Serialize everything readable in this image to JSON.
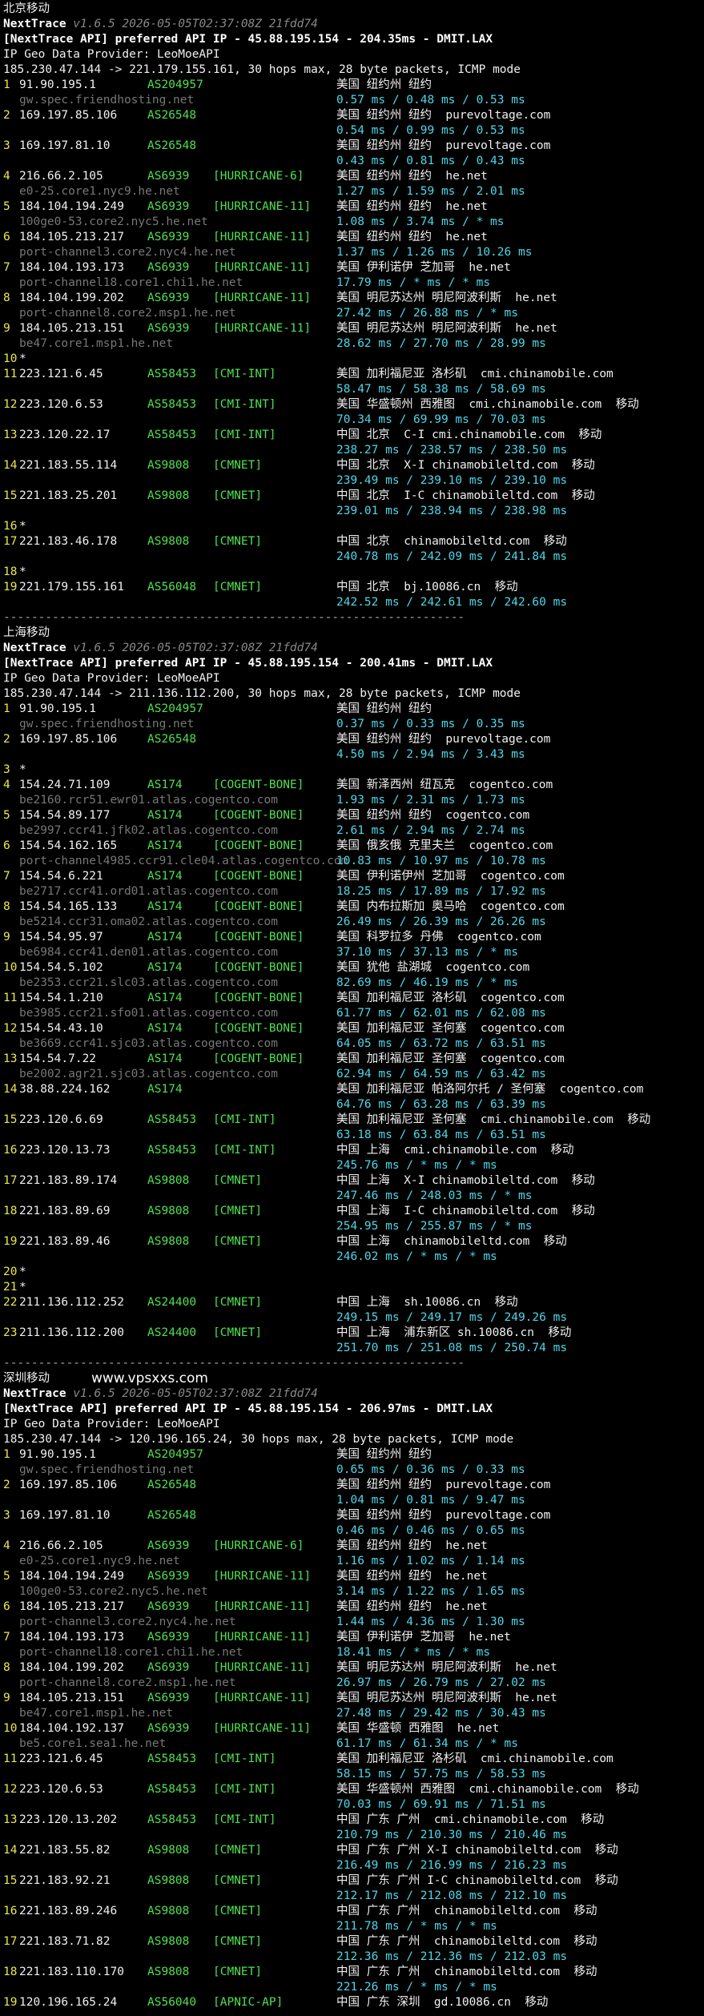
{
  "brand": "NextTrace",
  "meta": "v1.6.5 2026-05-05T02:37:08Z 21fdd74",
  "geo_provider": "IP Geo Data Provider: LeoMoeAPI",
  "separator": "------------------------------------------------------------------",
  "watermark": "www.vpsxxs.com",
  "sections": [
    {
      "title": "北京移动",
      "api": "[NextTrace API] preferred API IP - 45.88.195.154 - 204.35ms - DMIT.LAX",
      "route": "185.230.47.144 -> 221.179.155.161, 30 hops max, 28 byte packets, ICMP mode",
      "hops": [
        {
          "n": "1",
          "ip": "91.90.195.1",
          "as": "AS204957",
          "tag": "",
          "geo": "美国 纽约州 纽约",
          "host": "gw.spec.friendhosting.net",
          "lat": "0.57 ms / 0.48 ms / 0.53 ms"
        },
        {
          "n": "2",
          "ip": "169.197.85.106",
          "as": "AS26548",
          "tag": "",
          "geo": "美国 纽约州 纽约  purevoltage.com",
          "host": "",
          "lat": "0.54 ms / 0.99 ms / 0.53 ms"
        },
        {
          "n": "3",
          "ip": "169.197.81.10",
          "as": "AS26548",
          "tag": "",
          "geo": "美国 纽约州 纽约  purevoltage.com",
          "host": "",
          "lat": "0.43 ms / 0.81 ms / 0.43 ms"
        },
        {
          "n": "4",
          "ip": "216.66.2.105",
          "as": "AS6939",
          "tag": "[HURRICANE-6]",
          "geo": "美国 纽约州 纽约  he.net",
          "host": "e0-25.core1.nyc9.he.net",
          "lat": "1.27 ms / 1.59 ms / 2.01 ms"
        },
        {
          "n": "5",
          "ip": "184.104.194.249",
          "as": "AS6939",
          "tag": "[HURRICANE-11]",
          "geo": "美国 纽约州 纽约  he.net",
          "host": "100ge0-53.core2.nyc5.he.net",
          "lat": "1.08 ms / 3.74 ms / * ms"
        },
        {
          "n": "6",
          "ip": "184.105.213.217",
          "as": "AS6939",
          "tag": "[HURRICANE-11]",
          "geo": "美国 纽约州 纽约  he.net",
          "host": "port-channel3.core2.nyc4.he.net",
          "lat": "1.37 ms / 1.26 ms / 10.26 ms"
        },
        {
          "n": "7",
          "ip": "184.104.193.173",
          "as": "AS6939",
          "tag": "[HURRICANE-11]",
          "geo": "美国 伊利诺伊 芝加哥  he.net",
          "host": "port-channel18.core1.chi1.he.net",
          "lat": "17.79 ms / * ms / * ms"
        },
        {
          "n": "8",
          "ip": "184.104.199.202",
          "as": "AS6939",
          "tag": "[HURRICANE-11]",
          "geo": "美国 明尼苏达州 明尼阿波利斯  he.net",
          "host": "port-channel8.core2.msp1.he.net",
          "lat": "27.42 ms / 26.88 ms / * ms"
        },
        {
          "n": "9",
          "ip": "184.105.213.151",
          "as": "AS6939",
          "tag": "[HURRICANE-11]",
          "geo": "美国 明尼苏达州 明尼阿波利斯  he.net",
          "host": "be47.core1.msp1.he.net",
          "lat": "28.62 ms / 27.70 ms / 28.99 ms"
        },
        {
          "n": "10",
          "ip": "*",
          "as": "",
          "tag": "",
          "geo": "",
          "host": "",
          "lat": ""
        },
        {
          "n": "11",
          "ip": "223.121.6.45",
          "as": "AS58453",
          "tag": "[CMI-INT]",
          "geo": "美国 加利福尼亚 洛杉矶  cmi.chinamobile.com",
          "host": "",
          "lat": "58.47 ms / 58.38 ms / 58.69 ms"
        },
        {
          "n": "12",
          "ip": "223.120.6.53",
          "as": "AS58453",
          "tag": "[CMI-INT]",
          "geo": "美国 华盛顿州 西雅图  cmi.chinamobile.com  移动",
          "host": "",
          "lat": "70.34 ms / 69.99 ms / 70.03 ms"
        },
        {
          "n": "13",
          "ip": "223.120.22.17",
          "as": "AS58453",
          "tag": "[CMI-INT]",
          "geo": "中国 北京  C-I cmi.chinamobile.com  移动",
          "host": "",
          "lat": "238.27 ms / 238.57 ms / 238.50 ms"
        },
        {
          "n": "14",
          "ip": "221.183.55.114",
          "as": "AS9808",
          "tag": "[CMNET]",
          "geo": "中国 北京  X-I chinamobileltd.com  移动",
          "host": "",
          "lat": "239.49 ms / 239.10 ms / 239.10 ms"
        },
        {
          "n": "15",
          "ip": "221.183.25.201",
          "as": "AS9808",
          "tag": "[CMNET]",
          "geo": "中国 北京  I-C chinamobileltd.com  移动",
          "host": "",
          "lat": "239.01 ms / 238.94 ms / 238.98 ms"
        },
        {
          "n": "16",
          "ip": "*",
          "as": "",
          "tag": "",
          "geo": "",
          "host": "",
          "lat": ""
        },
        {
          "n": "17",
          "ip": "221.183.46.178",
          "as": "AS9808",
          "tag": "[CMNET]",
          "geo": "中国 北京  chinamobileltd.com  移动",
          "host": "",
          "lat": "240.78 ms / 242.09 ms / 241.84 ms"
        },
        {
          "n": "18",
          "ip": "*",
          "as": "",
          "tag": "",
          "geo": "",
          "host": "",
          "lat": ""
        },
        {
          "n": "19",
          "ip": "221.179.155.161",
          "as": "AS56048",
          "tag": "[CMNET]",
          "geo": "中国 北京  bj.10086.cn  移动",
          "host": "",
          "lat": "242.52 ms / 242.61 ms / 242.60 ms"
        }
      ]
    },
    {
      "title": "上海移动",
      "api": "[NextTrace API] preferred API IP - 45.88.195.154 - 200.41ms - DMIT.LAX",
      "route": "185.230.47.144 -> 211.136.112.200, 30 hops max, 28 byte packets, ICMP mode",
      "hops": [
        {
          "n": "1",
          "ip": "91.90.195.1",
          "as": "AS204957",
          "tag": "",
          "geo": "美国 纽约州 纽约",
          "host": "gw.spec.friendhosting.net",
          "lat": "0.37 ms / 0.33 ms / 0.35 ms"
        },
        {
          "n": "2",
          "ip": "169.197.85.106",
          "as": "AS26548",
          "tag": "",
          "geo": "美国 纽约州 纽约  purevoltage.com",
          "host": "",
          "lat": "4.50 ms / 2.94 ms / 3.43 ms"
        },
        {
          "n": "3",
          "ip": "*",
          "as": "",
          "tag": "",
          "geo": "",
          "host": "",
          "lat": ""
        },
        {
          "n": "4",
          "ip": "154.24.71.109",
          "as": "AS174",
          "tag": "[COGENT-BONE]",
          "geo": "美国 新泽西州 纽瓦克  cogentco.com",
          "host": "be2160.rcr51.ewr01.atlas.cogentco.com",
          "lat": "1.93 ms / 2.31 ms / 1.73 ms"
        },
        {
          "n": "5",
          "ip": "154.54.89.177",
          "as": "AS174",
          "tag": "[COGENT-BONE]",
          "geo": "美国 纽约州 纽约  cogentco.com",
          "host": "be2997.ccr41.jfk02.atlas.cogentco.com",
          "lat": "2.61 ms / 2.94 ms / 2.74 ms"
        },
        {
          "n": "6",
          "ip": "154.54.162.165",
          "as": "AS174",
          "tag": "[COGENT-BONE]",
          "geo": "美国 俄亥俄 克里夫兰  cogentco.com",
          "host": "port-channel4985.ccr91.cle04.atlas.cogentco.com",
          "lat": "10.83 ms / 10.97 ms / 10.78 ms"
        },
        {
          "n": "7",
          "ip": "154.54.6.221",
          "as": "AS174",
          "tag": "[COGENT-BONE]",
          "geo": "美国 伊利诺伊州 芝加哥  cogentco.com",
          "host": "be2717.ccr41.ord01.atlas.cogentco.com",
          "lat": "18.25 ms / 17.89 ms / 17.92 ms"
        },
        {
          "n": "8",
          "ip": "154.54.165.133",
          "as": "AS174",
          "tag": "[COGENT-BONE]",
          "geo": "美国 内布拉斯加 奥马哈  cogentco.com",
          "host": "be5214.ccr31.oma02.atlas.cogentco.com",
          "lat": "26.49 ms / 26.39 ms / 26.26 ms"
        },
        {
          "n": "9",
          "ip": "154.54.95.97",
          "as": "AS174",
          "tag": "[COGENT-BONE]",
          "geo": "美国 科罗拉多 丹佛  cogentco.com",
          "host": "be6984.ccr41.den01.atlas.cogentco.com",
          "lat": "37.10 ms / 37.13 ms / * ms"
        },
        {
          "n": "10",
          "ip": "154.54.5.102",
          "as": "AS174",
          "tag": "[COGENT-BONE]",
          "geo": "美国 犹他 盐湖城  cogentco.com",
          "host": "be2353.ccr21.slc03.atlas.cogentco.com",
          "lat": "82.69 ms / 46.19 ms / * ms"
        },
        {
          "n": "11",
          "ip": "154.54.1.210",
          "as": "AS174",
          "tag": "[COGENT-BONE]",
          "geo": "美国 加利福尼亚 洛杉矶  cogentco.com",
          "host": "be3985.ccr21.sfo01.atlas.cogentco.com",
          "lat": "61.77 ms / 62.01 ms / 62.08 ms"
        },
        {
          "n": "12",
          "ip": "154.54.43.10",
          "as": "AS174",
          "tag": "[COGENT-BONE]",
          "geo": "美国 加利福尼亚 圣何塞  cogentco.com",
          "host": "be3669.ccr41.sjc03.atlas.cogentco.com",
          "lat": "64.05 ms / 63.72 ms / 63.51 ms"
        },
        {
          "n": "13",
          "ip": "154.54.7.22",
          "as": "AS174",
          "tag": "[COGENT-BONE]",
          "geo": "美国 加利福尼亚 圣何塞  cogentco.com",
          "host": "be2002.agr21.sjc03.atlas.cogentco.com",
          "lat": "62.94 ms / 64.59 ms / 63.42 ms"
        },
        {
          "n": "14",
          "ip": "38.88.224.162",
          "as": "AS174",
          "tag": "",
          "geo": "美国 加利福尼亚 帕洛阿尔托 / 圣何塞  cogentco.com",
          "host": "",
          "lat": "64.76 ms / 63.28 ms / 63.39 ms"
        },
        {
          "n": "15",
          "ip": "223.120.6.69",
          "as": "AS58453",
          "tag": "[CMI-INT]",
          "geo": "美国 加利福尼亚 圣何塞  cmi.chinamobile.com  移动",
          "host": "",
          "lat": "63.18 ms / 63.84 ms / 63.51 ms"
        },
        {
          "n": "16",
          "ip": "223.120.13.73",
          "as": "AS58453",
          "tag": "[CMI-INT]",
          "geo": "中国 上海  cmi.chinamobile.com  移动",
          "host": "",
          "lat": "245.76 ms / * ms / * ms"
        },
        {
          "n": "17",
          "ip": "221.183.89.174",
          "as": "AS9808",
          "tag": "[CMNET]",
          "geo": "中国 上海  X-I chinamobileltd.com  移动",
          "host": "",
          "lat": "247.46 ms / 248.03 ms / * ms"
        },
        {
          "n": "18",
          "ip": "221.183.89.69",
          "as": "AS9808",
          "tag": "[CMNET]",
          "geo": "中国 上海  I-C chinamobileltd.com  移动",
          "host": "",
          "lat": "254.95 ms / 255.87 ms / * ms"
        },
        {
          "n": "19",
          "ip": "221.183.89.46",
          "as": "AS9808",
          "tag": "[CMNET]",
          "geo": "中国 上海  chinamobileltd.com  移动",
          "host": "",
          "lat": "246.02 ms / * ms / * ms"
        },
        {
          "n": "20",
          "ip": "*",
          "as": "",
          "tag": "",
          "geo": "",
          "host": "",
          "lat": ""
        },
        {
          "n": "21",
          "ip": "*",
          "as": "",
          "tag": "",
          "geo": "",
          "host": "",
          "lat": ""
        },
        {
          "n": "22",
          "ip": "211.136.112.252",
          "as": "AS24400",
          "tag": "[CMNET]",
          "geo": "中国 上海  sh.10086.cn  移动",
          "host": "",
          "lat": "249.15 ms / 249.17 ms / 249.26 ms"
        },
        {
          "n": "23",
          "ip": "211.136.112.200",
          "as": "AS24400",
          "tag": "[CMNET]",
          "geo": "中国 上海  浦东新区 sh.10086.cn  移动",
          "host": "",
          "lat": "251.70 ms / 251.08 ms / 250.74 ms"
        }
      ]
    },
    {
      "title": "深圳移动",
      "api": "[NextTrace API] preferred API IP - 45.88.195.154 - 206.97ms - DMIT.LAX",
      "route": "185.230.47.144 -> 120.196.165.24, 30 hops max, 28 byte packets, ICMP mode",
      "hops": [
        {
          "n": "1",
          "ip": "91.90.195.1",
          "as": "AS204957",
          "tag": "",
          "geo": "美国 纽约州 纽约",
          "host": "gw.spec.friendhosting.net",
          "lat": "0.65 ms / 0.36 ms / 0.33 ms"
        },
        {
          "n": "2",
          "ip": "169.197.85.106",
          "as": "AS26548",
          "tag": "",
          "geo": "美国 纽约州 纽约  purevoltage.com",
          "host": "",
          "lat": "1.04 ms / 0.81 ms / 9.47 ms"
        },
        {
          "n": "3",
          "ip": "169.197.81.10",
          "as": "AS26548",
          "tag": "",
          "geo": "美国 纽约州 纽约  purevoltage.com",
          "host": "",
          "lat": "0.46 ms / 0.46 ms / 0.65 ms"
        },
        {
          "n": "4",
          "ip": "216.66.2.105",
          "as": "AS6939",
          "tag": "[HURRICANE-6]",
          "geo": "美国 纽约州 纽约  he.net",
          "host": "e0-25.core1.nyc9.he.net",
          "lat": "1.16 ms / 1.02 ms / 1.14 ms"
        },
        {
          "n": "5",
          "ip": "184.104.194.249",
          "as": "AS6939",
          "tag": "[HURRICANE-11]",
          "geo": "美国 纽约州 纽约  he.net",
          "host": "100ge0-53.core2.nyc5.he.net",
          "lat": "3.14 ms / 1.22 ms / 1.65 ms"
        },
        {
          "n": "6",
          "ip": "184.105.213.217",
          "as": "AS6939",
          "tag": "[HURRICANE-11]",
          "geo": "美国 纽约州 纽约  he.net",
          "host": "port-channel3.core2.nyc4.he.net",
          "lat": "1.44 ms / 4.36 ms / 1.30 ms"
        },
        {
          "n": "7",
          "ip": "184.104.193.173",
          "as": "AS6939",
          "tag": "[HURRICANE-11]",
          "geo": "美国 伊利诺伊 芝加哥  he.net",
          "host": "port-channel18.core1.chi1.he.net",
          "lat": "18.41 ms / * ms / * ms"
        },
        {
          "n": "8",
          "ip": "184.104.199.202",
          "as": "AS6939",
          "tag": "[HURRICANE-11]",
          "geo": "美国 明尼苏达州 明尼阿波利斯  he.net",
          "host": "port-channel8.core2.msp1.he.net",
          "lat": "26.97 ms / 26.79 ms / 27.02 ms"
        },
        {
          "n": "9",
          "ip": "184.105.213.151",
          "as": "AS6939",
          "tag": "[HURRICANE-11]",
          "geo": "美国 明尼苏达州 明尼阿波利斯  he.net",
          "host": "be47.core1.msp1.he.net",
          "lat": "27.48 ms / 29.42 ms / 30.43 ms"
        },
        {
          "n": "10",
          "ip": "184.104.192.137",
          "as": "AS6939",
          "tag": "[HURRICANE-11]",
          "geo": "美国 华盛顿 西雅图  he.net",
          "host": "be5.core1.sea1.he.net",
          "lat": "61.17 ms / 61.34 ms / * ms"
        },
        {
          "n": "11",
          "ip": "223.121.6.45",
          "as": "AS58453",
          "tag": "[CMI-INT]",
          "geo": "美国 加利福尼亚 洛杉矶  cmi.chinamobile.com",
          "host": "",
          "lat": "58.15 ms / 57.75 ms / 58.53 ms"
        },
        {
          "n": "12",
          "ip": "223.120.6.53",
          "as": "AS58453",
          "tag": "[CMI-INT]",
          "geo": "美国 华盛顿州 西雅图  cmi.chinamobile.com  移动",
          "host": "",
          "lat": "70.03 ms / 69.91 ms / 71.51 ms"
        },
        {
          "n": "13",
          "ip": "223.120.13.202",
          "as": "AS58453",
          "tag": "[CMI-INT]",
          "geo": "中国 广东 广州  cmi.chinamobile.com  移动",
          "host": "",
          "lat": "210.79 ms / 210.30 ms / 210.46 ms"
        },
        {
          "n": "14",
          "ip": "221.183.55.82",
          "as": "AS9808",
          "tag": "[CMNET]",
          "geo": "中国 广东 广州 X-I chinamobileltd.com  移动",
          "host": "",
          "lat": "216.49 ms / 216.99 ms / 216.23 ms"
        },
        {
          "n": "15",
          "ip": "221.183.92.21",
          "as": "AS9808",
          "tag": "[CMNET]",
          "geo": "中国 广东 广州 I-C chinamobileltd.com  移动",
          "host": "",
          "lat": "212.17 ms / 212.08 ms / 212.10 ms"
        },
        {
          "n": "16",
          "ip": "221.183.89.246",
          "as": "AS9808",
          "tag": "[CMNET]",
          "geo": "中国 广东 广州  chinamobileltd.com  移动",
          "host": "",
          "lat": "211.78 ms / * ms / * ms"
        },
        {
          "n": "17",
          "ip": "221.183.71.82",
          "as": "AS9808",
          "tag": "[CMNET]",
          "geo": "中国 广东 广州  chinamobileltd.com  移动",
          "host": "",
          "lat": "212.36 ms / 212.36 ms / 212.03 ms"
        },
        {
          "n": "18",
          "ip": "221.183.110.170",
          "as": "AS9808",
          "tag": "[CMNET]",
          "geo": "中国 广东 广州  chinamobileltd.com  移动",
          "host": "",
          "lat": "221.26 ms / * ms / * ms"
        },
        {
          "n": "19",
          "ip": "120.196.165.24",
          "as": "AS56040",
          "tag": "[APNIC-AP]",
          "geo": "中国 广东 深圳  gd.10086.cn  移动",
          "host": "",
          "lat": ""
        }
      ]
    }
  ]
}
